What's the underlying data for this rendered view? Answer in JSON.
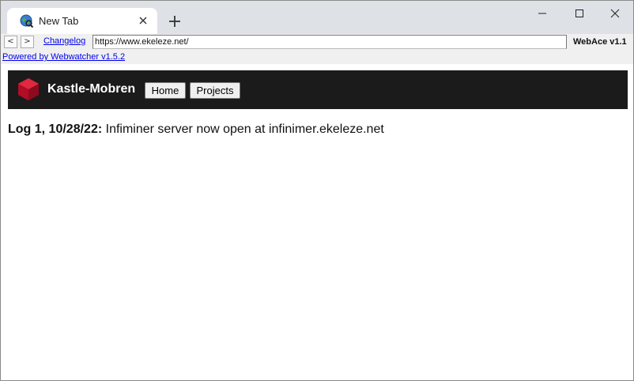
{
  "browser": {
    "tab_title": "New Tab",
    "changelog_label": "Changelog",
    "url": "https://www.ekeleze.net/",
    "brand": "WebAce v1.1",
    "powered_by": "Powered by Webwatcher v1.5.2",
    "back_label": "<",
    "forward_label": ">"
  },
  "site": {
    "name": "Kastle-Mobren",
    "nav": [
      "Home",
      "Projects"
    ],
    "log_label": "Log 1, 10/28/22:",
    "log_text": " Infiminer server now open at infinimer.ekeleze.net"
  },
  "colors": {
    "titlebar": "#dee1e6",
    "header_bg": "#1b1b1b",
    "logo_red": "#c8102e",
    "link": "#0000ee"
  }
}
